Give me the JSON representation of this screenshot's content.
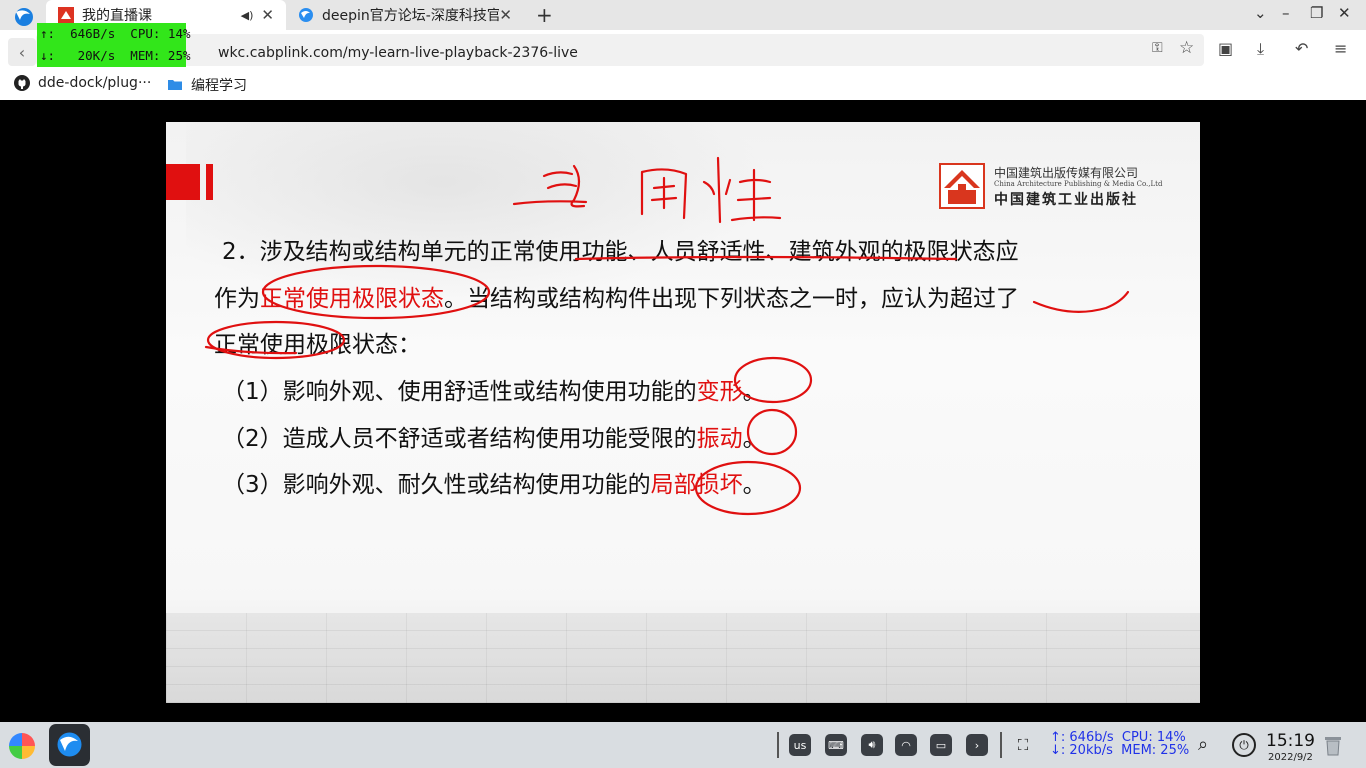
{
  "browser": {
    "tabs": [
      {
        "title": "我的直播课",
        "active": true,
        "muted_icon": "speaker-icon"
      },
      {
        "title": "deepin官方论坛-深度科技官",
        "active": false
      }
    ],
    "new_tab": "+",
    "window_controls": {
      "minimize": "–",
      "restore": "❐",
      "close": "✕",
      "menu": "⌄"
    },
    "url": "wkc.cabplink.com/my-learn-live-playback-2376-live",
    "bookmarks": [
      {
        "label": "dde-dock/plug···",
        "icon": "github-icon"
      },
      {
        "label": "编程学习",
        "icon": "folder-icon"
      }
    ]
  },
  "overlay_monitor": {
    "up": "↑:  646B/s  CPU: 14%",
    "down": "↓:   20K/s  MEM: 25%"
  },
  "slide": {
    "publisher_cn": "中国建筑出版传媒有限公司",
    "publisher_en": "China Architecture Publishing & Media Co.,Ltd",
    "publisher_calligraphy": "中国建筑工业出版社",
    "para_num": "2．",
    "para_l1": "涉及结构或结构单元的正常使用功能、人员舒适性、建筑外观的极限状态应",
    "para_l2_a": "作为",
    "para_l2_hl": "正常使用极限状态",
    "para_l2_b": "。当结构或结构构件出现下列状态之一时，应认为超过了",
    "para_l3": "正常使用极限状态：",
    "item1_a": "（1）影响外观、使用舒适性或结构使用功能的",
    "item1_hl": "变形",
    "item1_b": "。",
    "item2_a": "（2）造成人员不舒适或者结构使用功能受限的",
    "item2_hl": "振动",
    "item2_b": "。",
    "item3_a": "（3）影响外观、耐久性或结构使用功能的",
    "item3_hl": "局部损坏",
    "item3_b": "。"
  },
  "taskbar": {
    "keyboard_layout": "us",
    "net_up": "↑: 646b/s  CPU: 14%",
    "net_down": "↓: 20kb/s  MEM: 25%",
    "time": "15:19",
    "date": "2022/9/2"
  },
  "colors": {
    "accent_red": "#e01010",
    "monitor_green": "#32e61a",
    "taskbar_blue_text": "#2032e8"
  }
}
